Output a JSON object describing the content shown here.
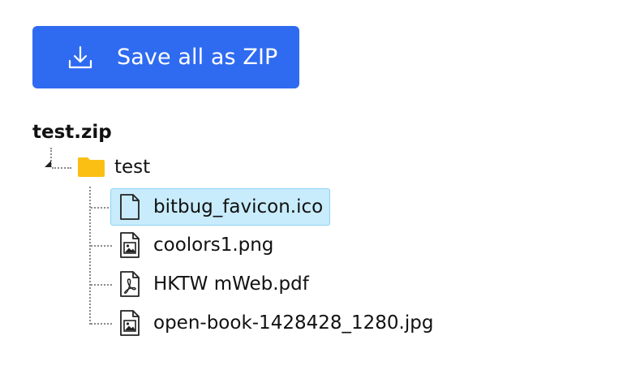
{
  "toolbar": {
    "save_zip_label": "Save all as ZIP",
    "save_zip_icon": "download-icon",
    "accent_color": "#2f6bf0"
  },
  "archive": {
    "name": "test.zip",
    "folder": {
      "name": "test",
      "icon": "folder-icon",
      "color": "#fbbf14"
    },
    "files": [
      {
        "name": "bitbug_favicon.ico",
        "icon": "generic-file-icon",
        "selected": true
      },
      {
        "name": "coolors1.png",
        "icon": "image-file-icon",
        "selected": false
      },
      {
        "name": "HKTW mWeb.pdf",
        "icon": "pdf-file-icon",
        "selected": false
      },
      {
        "name": "open-book-1428428_1280.jpg",
        "icon": "image-file-icon",
        "selected": false
      }
    ]
  },
  "selection_color": "#c8ecfb"
}
